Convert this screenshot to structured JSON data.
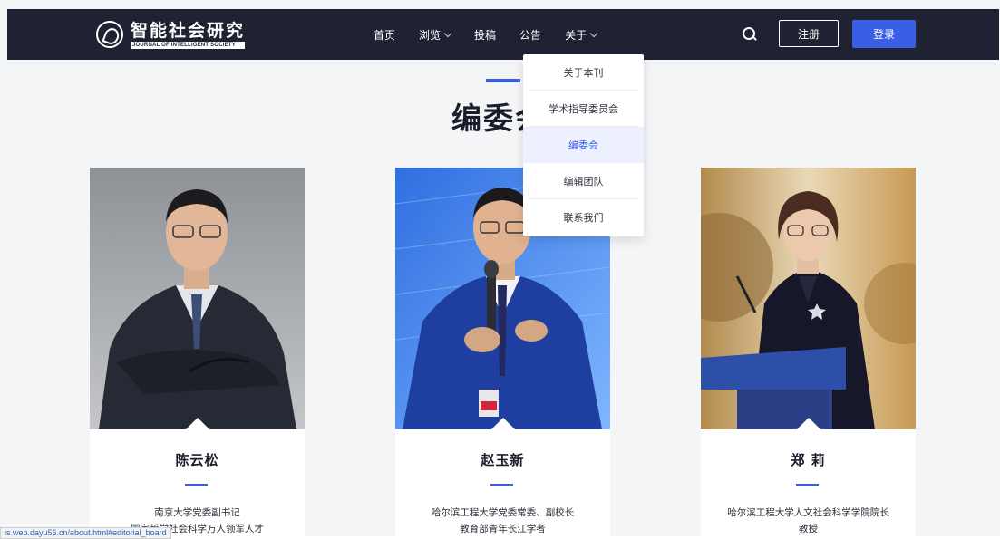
{
  "header": {
    "logo_cn": "智能社会研究",
    "logo_en": "JOURNAL OF INTELLIGENT SOCIETY",
    "nav": [
      {
        "label": "首页",
        "has_dropdown": false
      },
      {
        "label": "浏览",
        "has_dropdown": true
      },
      {
        "label": "投稿",
        "has_dropdown": false
      },
      {
        "label": "公告",
        "has_dropdown": false
      },
      {
        "label": "关于",
        "has_dropdown": true
      }
    ],
    "register_label": "注册",
    "login_label": "登录",
    "accent": "#3a5fe5"
  },
  "dropdown": {
    "items": [
      "关于本刊",
      "学术指导委员会",
      "编委会",
      "编辑团队",
      "联系我们"
    ],
    "active_index": 2
  },
  "section": {
    "title": "编委会"
  },
  "cards": [
    {
      "name": "陈云松",
      "desc_lines": [
        "南京大学党委副书记",
        "国家哲学社会科学万人领军人才"
      ]
    },
    {
      "name": "赵玉新",
      "desc_lines": [
        "哈尔滨工程大学党委常委、副校长",
        "教育部青年长江学者"
      ]
    },
    {
      "name": "郑 莉",
      "desc_lines": [
        "哈尔滨工程大学人文社会科学学院院长",
        "教授"
      ]
    }
  ],
  "status_url": "is.web.dayu56.cn/about.html#editorial_board"
}
